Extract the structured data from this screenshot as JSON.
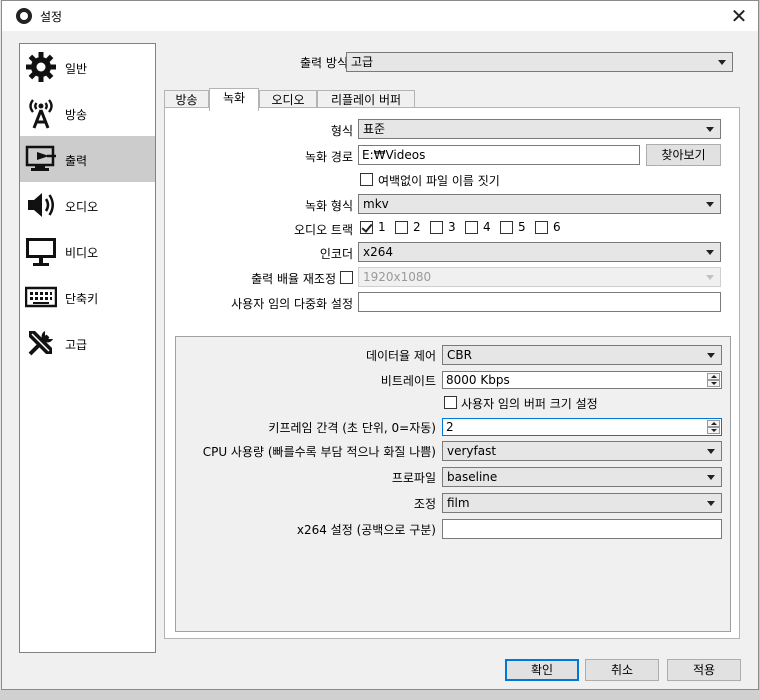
{
  "window": {
    "title": "설정",
    "close_glyph": "✕"
  },
  "sidebar": {
    "items": [
      {
        "label": "일반",
        "icon": "gear-icon"
      },
      {
        "label": "방송",
        "icon": "broadcast-icon"
      },
      {
        "label": "출력",
        "icon": "output-icon",
        "active": true
      },
      {
        "label": "오디오",
        "icon": "speaker-icon"
      },
      {
        "label": "비디오",
        "icon": "monitor-icon"
      },
      {
        "label": "단축키",
        "icon": "keyboard-icon"
      },
      {
        "label": "고급",
        "icon": "tools-icon"
      }
    ]
  },
  "output_mode": {
    "label": "출력 방식",
    "value": "고급"
  },
  "tabs": [
    "방송",
    "녹화",
    "오디오",
    "리플레이 버퍼"
  ],
  "active_tab": "녹화",
  "recording": {
    "type_label": "형식",
    "type_value": "표준",
    "path_label": "녹화 경로",
    "path_value": "E:₩Videos",
    "browse_label": "찾아보기",
    "no_space_label": "여백없이 파일 이름 짓기",
    "format_label": "녹화 형식",
    "format_value": "mkv",
    "audio_track_label": "오디오 트랙",
    "tracks": [
      {
        "num": "1",
        "checked": true
      },
      {
        "num": "2",
        "checked": false
      },
      {
        "num": "3",
        "checked": false
      },
      {
        "num": "4",
        "checked": false
      },
      {
        "num": "5",
        "checked": false
      },
      {
        "num": "6",
        "checked": false
      }
    ],
    "encoder_label": "인코더",
    "encoder_value": "x264",
    "rescale_label": "출력 배율 재조정",
    "rescale_value": "1920x1080",
    "muxer_label": "사용자 임의 다중화 설정",
    "muxer_value": ""
  },
  "encoder_settings": {
    "rate_control_label": "데이터율 제어",
    "rate_control_value": "CBR",
    "bitrate_label": "비트레이트",
    "bitrate_value": "8000 Kbps",
    "custom_buffer_label": "사용자 임의 버퍼 크기 설정",
    "keyframe_label": "키프레임 간격 (초 단위, 0=자동)",
    "keyframe_value": "2",
    "cpu_label": "CPU 사용량 (빠를수록 부담 적으나 화질 나쁨)",
    "cpu_value": "veryfast",
    "profile_label": "프로파일",
    "profile_value": "baseline",
    "tune_label": "조정",
    "tune_value": "film",
    "x264_opts_label": "x264 설정 (공백으로 구분)",
    "x264_opts_value": ""
  },
  "buttons": {
    "ok": "확인",
    "cancel": "취소",
    "apply": "적용"
  }
}
